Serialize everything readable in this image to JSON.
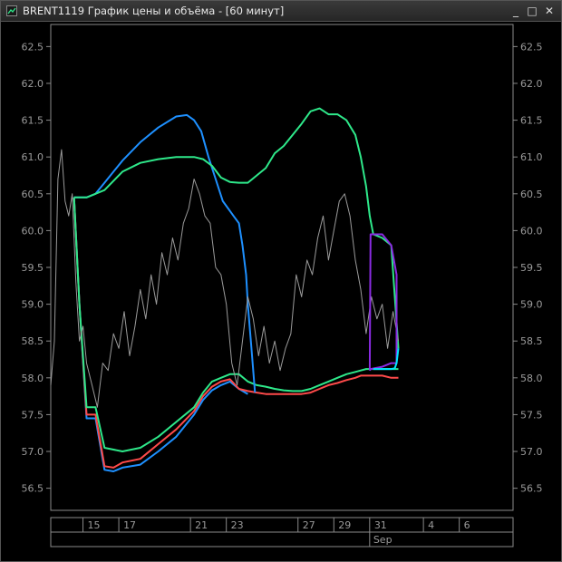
{
  "window": {
    "title": "BRENT1119 График цены и объёма - [60 минут]",
    "minimize_symbol": "_",
    "maximize_symbol": "□",
    "close_symbol": "✕",
    "app_icon": "chart-app-icon"
  },
  "chart_data": {
    "type": "line",
    "ylim": [
      56.2,
      62.8
    ],
    "y_ticks": [
      56.5,
      57.0,
      57.5,
      58.0,
      58.5,
      59.0,
      59.5,
      60.0,
      60.5,
      61.0,
      61.5,
      62.0,
      62.5
    ],
    "y_tick_labels": [
      "56.5",
      "57.0",
      "57.5",
      "58.0",
      "58.5",
      "59.0",
      "59.5",
      "60.0",
      "60.5",
      "61.0",
      "61.5",
      "62.0",
      "62.5"
    ],
    "xlim": [
      13,
      38.8
    ],
    "x_ticks": [
      15,
      17,
      21,
      23,
      27,
      29,
      31,
      34,
      36
    ],
    "x_tick_labels": [
      "15",
      "17",
      "21",
      "23",
      "27",
      "29",
      "31",
      "4",
      "6"
    ],
    "x_secondary_label": "Sep",
    "x_secondary_at": 31,
    "grid": false,
    "colors": {
      "price": "#9a9a9a",
      "upper_blue": "#1e90ff",
      "upper_green": "#2ee88a",
      "lower_green": "#2ee88a",
      "lower_red": "#ff4a4a",
      "lower_blue": "#1e90ff",
      "purple": "#8a2be2",
      "cyan": "#00e5ff"
    },
    "series": [
      {
        "key": "price",
        "x": [
          13,
          13.2,
          13.4,
          13.6,
          13.8,
          14.0,
          14.2,
          14.4,
          14.6,
          14.8,
          15.0,
          15.3,
          15.6,
          15.9,
          16.2,
          16.5,
          16.8,
          17.1,
          17.4,
          17.7,
          18.0,
          18.3,
          18.6,
          18.9,
          19.2,
          19.5,
          19.8,
          20.1,
          20.4,
          20.7,
          21.0,
          21.3,
          21.6,
          21.9,
          22.2,
          22.5,
          22.8,
          23.1,
          23.4,
          23.7,
          24.0,
          24.3,
          24.6,
          24.9,
          25.2,
          25.5,
          25.8,
          26.1,
          26.4,
          26.7,
          27.0,
          27.3,
          27.6,
          27.9,
          28.2,
          28.5,
          28.8,
          29.1,
          29.4,
          29.7,
          30.0,
          30.3,
          30.6,
          30.9,
          31.2,
          31.5,
          31.8,
          32.1,
          32.4
        ],
        "y": [
          57.9,
          58.5,
          60.7,
          61.1,
          60.4,
          60.2,
          60.5,
          59.3,
          58.5,
          58.7,
          58.2,
          57.9,
          57.6,
          58.2,
          58.1,
          58.6,
          58.4,
          58.9,
          58.3,
          58.7,
          59.2,
          58.8,
          59.4,
          59.0,
          59.7,
          59.4,
          59.9,
          59.6,
          60.1,
          60.3,
          60.7,
          60.5,
          60.2,
          60.1,
          59.5,
          59.4,
          59.0,
          58.2,
          57.9,
          58.5,
          59.1,
          58.8,
          58.3,
          58.7,
          58.2,
          58.5,
          58.1,
          58.4,
          58.6,
          59.4,
          59.1,
          59.6,
          59.4,
          59.9,
          60.2,
          59.6,
          60.0,
          60.4,
          60.5,
          60.2,
          59.6,
          59.2,
          58.6,
          59.1,
          58.8,
          59.0,
          58.4,
          58.9,
          58.5
        ]
      },
      {
        "key": "upper_blue",
        "x": [
          14.3,
          14.6,
          15.0,
          15.5,
          16.0,
          17.0,
          18.0,
          19.0,
          20.0,
          20.6,
          21.0,
          21.4,
          21.8,
          22.2,
          22.6,
          22.9,
          23.2,
          23.5,
          23.7,
          23.9,
          24.0,
          24.2,
          24.4
        ],
        "y": [
          60.45,
          60.45,
          60.45,
          60.5,
          60.65,
          60.95,
          61.2,
          61.4,
          61.55,
          61.57,
          61.5,
          61.35,
          61.0,
          60.7,
          60.4,
          60.3,
          60.2,
          60.1,
          59.8,
          59.4,
          59.0,
          58.4,
          57.8
        ]
      },
      {
        "key": "upper_green",
        "x": [
          14.3,
          14.6,
          15.0,
          15.5,
          16.0,
          17.0,
          18.0,
          19.0,
          20.0,
          21.0,
          21.5,
          22.0,
          22.5,
          23.0,
          23.5,
          24.0,
          24.5,
          25.0,
          25.5,
          26.0,
          26.5,
          27.0,
          27.5,
          28.0,
          28.5,
          29.0,
          29.5,
          30.0,
          30.3,
          30.6,
          30.8,
          31.0,
          31.5,
          32.0,
          32.4
        ],
        "y": [
          60.45,
          60.45,
          60.45,
          60.5,
          60.55,
          60.8,
          60.92,
          60.97,
          61.0,
          61.0,
          60.97,
          60.88,
          60.72,
          60.66,
          60.65,
          60.65,
          60.75,
          60.85,
          61.05,
          61.15,
          61.3,
          61.45,
          61.62,
          61.66,
          61.58,
          61.58,
          61.5,
          61.3,
          61.0,
          60.6,
          60.2,
          59.95,
          59.9,
          59.8,
          58.4
        ]
      },
      {
        "key": "lower_green",
        "x": [
          14.3,
          14.6,
          15.0,
          15.5,
          16.0,
          17.0,
          18.0,
          19.0,
          20.0,
          21.0,
          21.5,
          22.0,
          22.5,
          23.0,
          23.5,
          24.0,
          24.5,
          25.0,
          25.5,
          26.0,
          26.5,
          27.0,
          27.5,
          28.0,
          28.5,
          29.0,
          29.5,
          30.0,
          30.3,
          30.6,
          30.8,
          31.0,
          31.5,
          32.0,
          32.4
        ],
        "y": [
          60.45,
          59.0,
          57.6,
          57.6,
          57.05,
          57.0,
          57.05,
          57.2,
          57.4,
          57.6,
          57.8,
          57.95,
          58.0,
          58.05,
          58.05,
          57.95,
          57.9,
          57.88,
          57.85,
          57.83,
          57.82,
          57.82,
          57.85,
          57.9,
          57.95,
          58.0,
          58.05,
          58.08,
          58.1,
          58.12,
          58.12,
          58.12,
          58.12,
          58.12,
          58.12
        ]
      },
      {
        "key": "lower_red",
        "x": [
          14.3,
          14.6,
          15.0,
          15.5,
          16.0,
          16.5,
          17.0,
          18.0,
          19.0,
          20.0,
          21.0,
          21.5,
          22.0,
          22.5,
          23.0,
          23.5,
          24.0,
          24.5,
          25.0,
          25.5,
          26.0,
          26.5,
          27.0,
          27.5,
          28.0,
          28.5,
          29.0,
          29.5,
          30.0,
          30.3,
          30.6,
          30.8,
          31.0,
          31.5,
          32.0,
          32.4
        ],
        "y": [
          60.45,
          59.0,
          57.5,
          57.5,
          56.8,
          56.78,
          56.85,
          56.9,
          57.1,
          57.3,
          57.55,
          57.75,
          57.88,
          57.95,
          57.98,
          57.85,
          57.82,
          57.8,
          57.78,
          57.78,
          57.78,
          57.78,
          57.78,
          57.8,
          57.85,
          57.9,
          57.93,
          57.97,
          58.0,
          58.03,
          58.03,
          58.03,
          58.03,
          58.03,
          58.0,
          58.0
        ]
      },
      {
        "key": "lower_blue",
        "x": [
          14.3,
          14.6,
          15.0,
          15.5,
          16.0,
          16.5,
          17.0,
          18.0,
          19.0,
          20.0,
          21.0,
          21.5,
          22.0,
          22.5,
          23.0,
          23.5,
          24.0
        ],
        "y": [
          60.45,
          59.0,
          57.45,
          57.45,
          56.75,
          56.73,
          56.78,
          56.82,
          57.0,
          57.2,
          57.5,
          57.7,
          57.83,
          57.9,
          57.95,
          57.85,
          57.78
        ]
      },
      {
        "key": "purple",
        "x": [
          30.8,
          30.85,
          31.5,
          32.0,
          32.3,
          32.3,
          32.0,
          31.5,
          30.85,
          30.8
        ],
        "y": [
          58.1,
          59.95,
          59.95,
          59.8,
          59.4,
          58.2,
          58.2,
          58.15,
          58.12,
          58.1
        ]
      },
      {
        "key": "cyan",
        "x": [
          31.0,
          31.5,
          32.0,
          32.2,
          32.3,
          32.4
        ],
        "y": [
          58.12,
          58.12,
          58.12,
          58.13,
          58.2,
          58.4
        ]
      }
    ]
  }
}
